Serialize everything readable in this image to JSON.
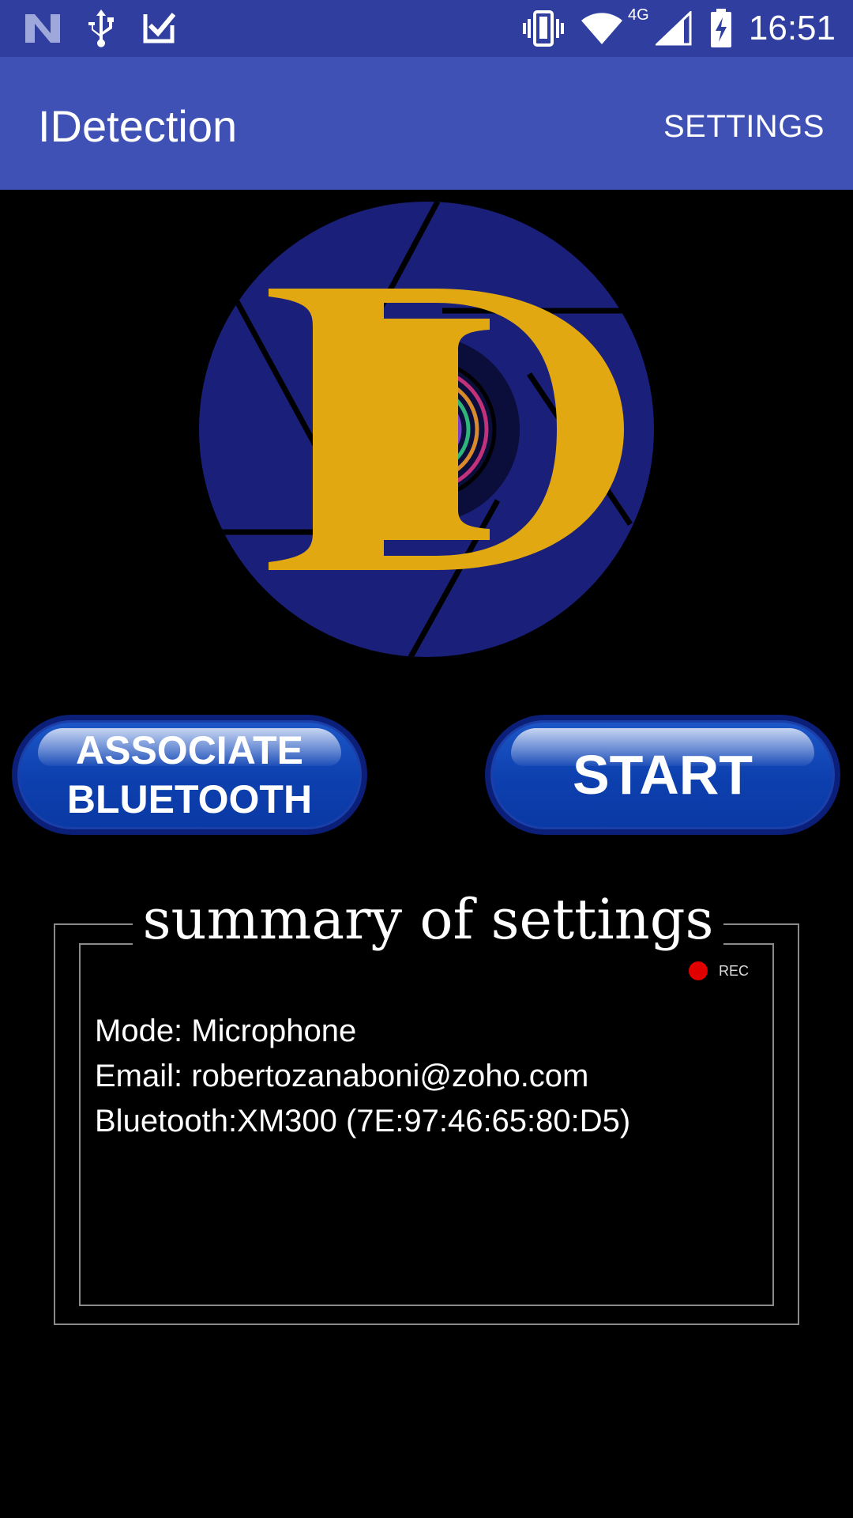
{
  "status_bar": {
    "time": "16:51",
    "network_label": "4G",
    "icons": [
      "n-logo-icon",
      "usb-icon",
      "task-check-icon",
      "vibrate-icon",
      "wifi-icon",
      "cell-signal-icon",
      "battery-charging-icon"
    ]
  },
  "app_bar": {
    "title": "IDetection",
    "settings_label": "SETTINGS",
    "color": "#3f51b5"
  },
  "buttons": {
    "associate_label": "ASSOCIATE\nBLUETOOTH",
    "start_label": "START"
  },
  "summary": {
    "title": "summary of settings",
    "rec_label": "REC",
    "lines": [
      "Mode: Microphone",
      "Email: robertozanaboni@zoho.com",
      "Bluetooth:XM300 (7E:97:46:65:80:D5)"
    ]
  },
  "colors": {
    "status_bar": "#303f9f",
    "logo_circle": "#1a1f7a",
    "logo_letters": "#e2a812",
    "button": "#0d3fae",
    "rec": "#e00000"
  }
}
